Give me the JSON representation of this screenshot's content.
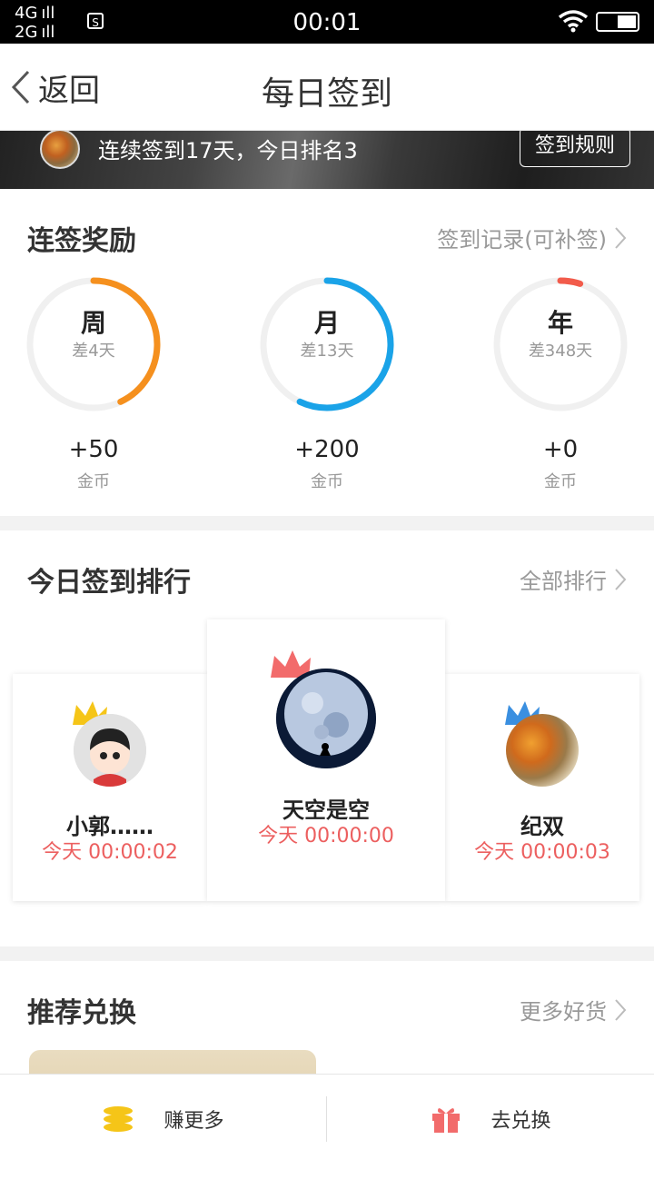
{
  "status_bar": {
    "net1": "4G",
    "net2": "2G",
    "sim_icon": "S",
    "time": "00:01"
  },
  "nav": {
    "back_label": "返回",
    "title": "每日签到"
  },
  "banner": {
    "text": "连续签到17天，今日排名3",
    "rules_button": "签到规则"
  },
  "streak": {
    "title": "连签奖励",
    "link": "签到记录(可补签)",
    "rings": [
      {
        "label": "周",
        "sub": "差4天",
        "reward": "+50",
        "unit": "金币",
        "progress": 0.43,
        "color": "#f5901e"
      },
      {
        "label": "月",
        "sub": "差13天",
        "reward": "+200",
        "unit": "金币",
        "progress": 0.57,
        "color": "#1aa3e8"
      },
      {
        "label": "年",
        "sub": "差348天",
        "reward": "+0",
        "unit": "金币",
        "progress": 0.05,
        "color": "#f25b4b"
      }
    ]
  },
  "ranking": {
    "title": "今日签到排行",
    "link": "全部排行",
    "entries": [
      {
        "rank": 1,
        "name": "天空是空",
        "time": "今天 00:00:00",
        "crown_color": "#f26b6b"
      },
      {
        "rank": 2,
        "name": "小郭……",
        "time": "今天 00:00:02",
        "crown_color": "#f5c518"
      },
      {
        "rank": 3,
        "name": "纪双",
        "time": "今天 00:00:03",
        "crown_color": "#3a8fe0"
      }
    ]
  },
  "recommend": {
    "title": "推荐兑换",
    "link": "更多好货"
  },
  "bottom_bar": {
    "earn_label": "赚更多",
    "redeem_label": "去兑换"
  },
  "colors": {
    "accent_red": "#ec5f5f",
    "coin_yellow": "#f5c518",
    "gift_red": "#f26b6b"
  }
}
